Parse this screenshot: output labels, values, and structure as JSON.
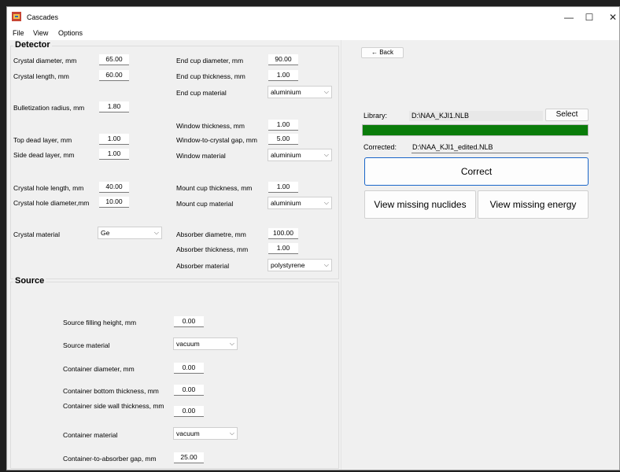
{
  "window": {
    "title": "Cascades",
    "minimize": "—",
    "maximize": "☐",
    "close": "✕"
  },
  "menu": [
    "File",
    "View",
    "Options"
  ],
  "detector": {
    "title": "Detector",
    "crystal_diameter": {
      "label": "Crystal diameter, mm",
      "value": "65.00"
    },
    "crystal_length": {
      "label": "Crystal length, mm",
      "value": "60.00"
    },
    "bulletization_radius": {
      "label": "Bulletization radius, mm",
      "value": "1.80"
    },
    "top_dead_layer": {
      "label": "Top dead layer, mm",
      "value": "1.00"
    },
    "side_dead_layer": {
      "label": "Side dead layer, mm",
      "value": "1.00"
    },
    "crystal_hole_length": {
      "label": "Crystal hole length, mm",
      "value": "40.00"
    },
    "crystal_hole_diameter": {
      "label": "Crystal hole diameter,mm",
      "value": "10.00"
    },
    "crystal_material": {
      "label": "Crystal material",
      "value": "Ge"
    },
    "end_cup_diameter": {
      "label": "End cup diameter, mm",
      "value": "90.00"
    },
    "end_cup_thickness": {
      "label": "End cup thickness, mm",
      "value": "1.00"
    },
    "end_cup_material": {
      "label": "End cup material",
      "value": "aluminium"
    },
    "window_thickness": {
      "label": "Window thickness, mm",
      "value": "1.00"
    },
    "window_gap": {
      "label": "Window-to-crystal gap, mm",
      "value": "5.00"
    },
    "window_material": {
      "label": "Window material",
      "value": "aluminium"
    },
    "mount_cup_thickness": {
      "label": "Mount cup thickness, mm",
      "value": "1.00"
    },
    "mount_cup_material": {
      "label": "Mount cup material",
      "value": "aluminium"
    },
    "absorber_diameter": {
      "label": "Absorber diametre, mm",
      "value": "100.00"
    },
    "absorber_thickness": {
      "label": "Absorber thickness, mm",
      "value": "1.00"
    },
    "absorber_material": {
      "label": "Absorber material",
      "value": "polystyrene"
    }
  },
  "source": {
    "title": "Source",
    "filling_height": {
      "label": "Source filling height, mm",
      "value": "0.00"
    },
    "source_material": {
      "label": "Source material",
      "value": "vacuum"
    },
    "container_diameter": {
      "label": "Container diameter, mm",
      "value": "0.00"
    },
    "container_bottom": {
      "label": "Container bottom thickness, mm",
      "value": "0.00"
    },
    "container_side": {
      "label": "Container side wall thickness, mm",
      "value": "0.00"
    },
    "container_material": {
      "label": "Container material",
      "value": "vacuum"
    },
    "container_gap": {
      "label": "Container-to-absorber gap, mm",
      "value": "25.00"
    }
  },
  "right": {
    "back_label": "← Back",
    "library_label": "Library:",
    "library_path": "D:\\NAA_KJI1.NLB",
    "select_label": "Select",
    "progress": 1.0,
    "progress_color": "#0a7c0a",
    "corrected_label": "Corrected:",
    "corrected_path": "D:\\NAA_KJI1_edited.NLB",
    "correct_label": "Correct",
    "missing_nuclides_label": "View missing nuclides",
    "missing_energy_label": "View missing energy"
  }
}
